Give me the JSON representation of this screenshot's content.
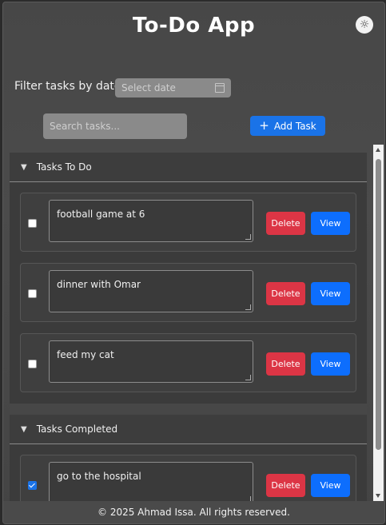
{
  "header": {
    "title": "To-Do App",
    "theme_icon": "sun-icon"
  },
  "filter": {
    "label": "Filter tasks by date:",
    "placeholder": "Select date"
  },
  "search": {
    "placeholder": "Search tasks..."
  },
  "add_button": {
    "label": "Add Task",
    "icon": "+"
  },
  "todo_section": {
    "title": "Tasks To Do",
    "tasks": [
      {
        "text": "football game at 6",
        "done": false,
        "delete_label": "Delete",
        "view_label": "View"
      },
      {
        "text": "dinner with Omar",
        "done": false,
        "delete_label": "Delete",
        "view_label": "View"
      },
      {
        "text": "feed my cat",
        "done": false,
        "delete_label": "Delete",
        "view_label": "View"
      }
    ]
  },
  "completed_section": {
    "title": "Tasks Completed",
    "tasks": [
      {
        "text": "go to the hospital",
        "done": true,
        "delete_label": "Delete",
        "view_label": "View"
      }
    ]
  },
  "footer": {
    "text": "© 2025 Ahmad Issa. All rights reserved."
  },
  "colors": {
    "accent": "#1a73e8",
    "danger": "#dc3545",
    "view": "#0d6efd"
  }
}
